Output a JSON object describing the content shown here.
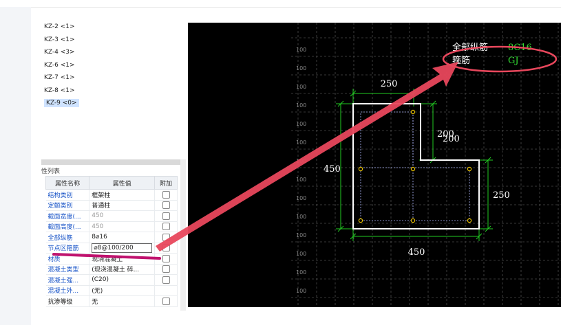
{
  "tree": {
    "items": [
      "KZ-2 <1>",
      "KZ-3 <1>",
      "KZ-4 <3>",
      "KZ-6 <1>",
      "KZ-7 <1>",
      "KZ-8 <1>",
      "KZ-9 <0>"
    ],
    "selected_index": 6
  },
  "props": {
    "title": "性列表",
    "headers": [
      "属性名称",
      "属性值",
      "附加"
    ],
    "rows": [
      {
        "name": "结构类别",
        "value": "框架柱"
      },
      {
        "name": "定额类别",
        "value": "普通柱"
      },
      {
        "name": "截面宽度(...",
        "value": "450"
      },
      {
        "name": "截面高度(...",
        "value": "450"
      },
      {
        "name": "全部纵筋",
        "value": "8⌀16"
      },
      {
        "name": "节点区箍筋",
        "value": "⌀8@100/200"
      },
      {
        "name": "材质",
        "value": "现浇混凝土"
      },
      {
        "name": "混凝土类型",
        "value": "(现浇混凝土  碎..."
      },
      {
        "name": "混凝土强...",
        "value": "(C20)"
      },
      {
        "name": "混凝土外...",
        "value": "(无)"
      },
      {
        "name": "抗渗等级",
        "value": "无"
      }
    ]
  },
  "cad": {
    "grid_label": "100",
    "info_line1_label": "全部纵筋",
    "info_line1_value": "8C16",
    "info_line2_label": "箍筋",
    "info_line2_value": "GJ",
    "dim_top": "250",
    "dim_inner_vertical": "200",
    "dim_inner_horizontal": "200",
    "dim_left": "450",
    "dim_right": "250",
    "dim_bottom": "450"
  },
  "colors": {
    "annotation_red": "#e8475c",
    "highlight_magenta": "#c0126e",
    "dim_green": "#22cc22",
    "rebar_yellow": "#e8c000",
    "value_green": "#33dd33"
  }
}
